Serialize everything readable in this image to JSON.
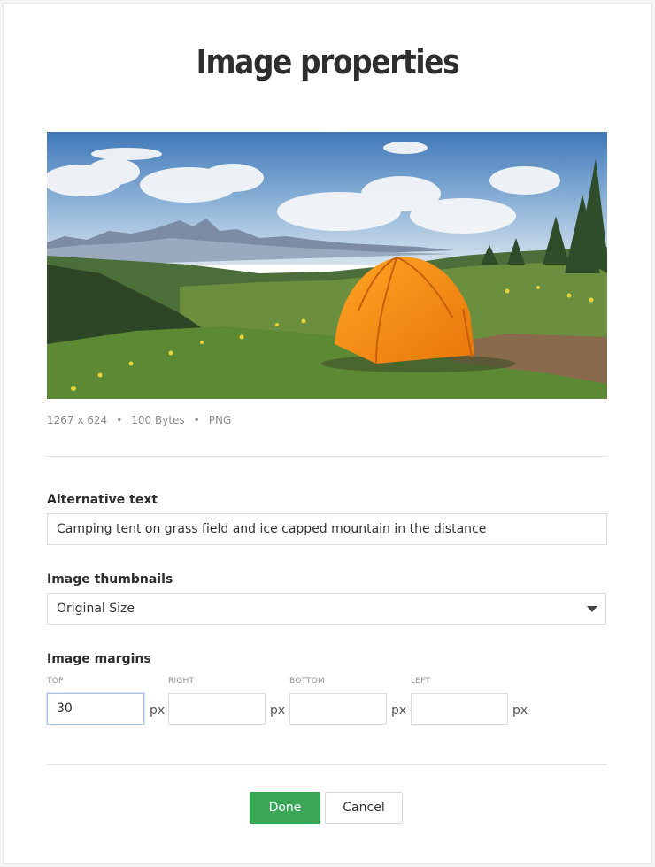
{
  "dialog": {
    "title": "Image properties"
  },
  "image": {
    "description": "camping tent on grass field with mountains",
    "dimensions": "1267 x 624",
    "size": "100 Bytes",
    "format": "PNG",
    "separator": "•"
  },
  "alt_text": {
    "label": "Alternative text",
    "value": "Camping tent on grass field and ice capped mountain in the distance"
  },
  "thumbnails": {
    "label": "Image thumbnails",
    "selected": "Original Size"
  },
  "margins": {
    "label": "Image margins",
    "unit": "px",
    "fields": [
      {
        "label": "TOP",
        "value": "30"
      },
      {
        "label": "RIGHT",
        "value": ""
      },
      {
        "label": "BOTTOM",
        "value": ""
      },
      {
        "label": "LEFT",
        "value": ""
      }
    ]
  },
  "actions": {
    "done_label": "Done",
    "cancel_label": "Cancel"
  },
  "colors": {
    "done_button": "#3aa757",
    "tent": "#f28c16",
    "focus_border": "#a9c3de"
  }
}
